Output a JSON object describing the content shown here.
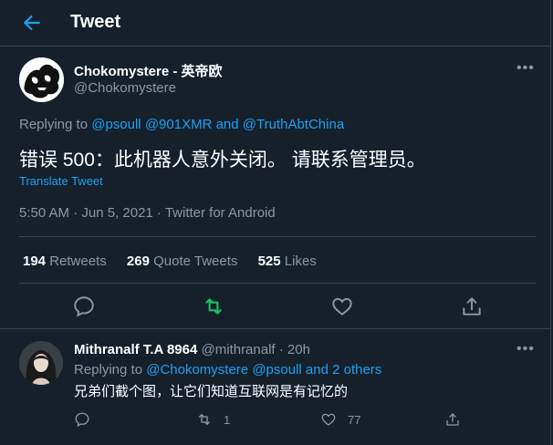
{
  "header": {
    "title": "Tweet"
  },
  "tweet": {
    "display_name": "Chokomystere - 英帝欧",
    "handle": "@Chokomystere",
    "replying_prefix": "Replying to ",
    "replying_to": [
      "@psoull",
      "@901XMR",
      "@TruthAbtChina"
    ],
    "replying_and": " and ",
    "text": "错误 500：此机器人意外关闭。 请联系管理员。",
    "translate_label": "Translate Tweet",
    "timestamp": "5:50 AM · Jun 5, 2021 · Twitter for Android",
    "stats": {
      "retweets_count": "194",
      "retweets_label": "Retweets",
      "quotes_count": "269",
      "quotes_label": "Quote Tweets",
      "likes_count": "525",
      "likes_label": "Likes"
    }
  },
  "reply": {
    "display_name": "Mithranalf T.A 8964",
    "handle": "@mithranalf · 20h",
    "replying_prefix": "Replying to ",
    "replying_mentions": "@Chokomystere @psoull and 2 others",
    "text": "兄弟们截个图，让它们知道互联网是有记忆的",
    "retweet_count": "1",
    "like_count": "77"
  },
  "colors": {
    "background": "#15202b",
    "accent": "#1da1f2",
    "retweet_active": "#17bf63",
    "muted": "#8899a6"
  }
}
